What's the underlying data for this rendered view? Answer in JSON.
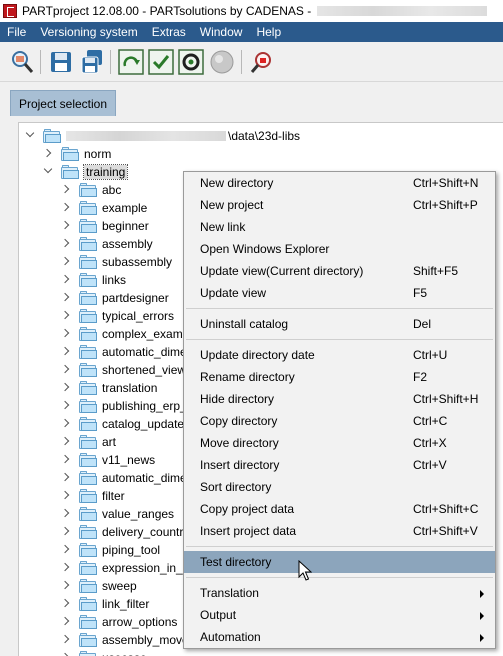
{
  "window": {
    "title": "PARTproject 12.08.00 - PARTsolutions by CADENAS - "
  },
  "menubar": {
    "items": [
      "File",
      "Versioning system",
      "Extras",
      "Window",
      "Help"
    ]
  },
  "toolbar": {
    "buttons": [
      "search-icon",
      "save-icon",
      "save-all-icon",
      "refresh-icon",
      "check-icon",
      "settings-icon",
      "globe-icon",
      "stop-search-icon"
    ]
  },
  "tabs": {
    "project_selection": "Project selection"
  },
  "tree": {
    "root_path": "\\data\\23d-libs",
    "norm": "norm",
    "training": "training",
    "children": [
      "abc",
      "example",
      "beginner",
      "assembly",
      "subassembly",
      "links",
      "partdesigner",
      "typical_errors",
      "complex_examp",
      "automatic_dime",
      "shortened_view",
      "translation",
      "publishing_erp_",
      "catalog_update_",
      "art",
      "v11_news",
      "automatic_dime",
      "filter",
      "value_ranges",
      "delivery_countr",
      "piping_tool",
      "expression_in_s",
      "sweep",
      "link_filter",
      "arrow_options",
      "assembly_move",
      "usecase"
    ]
  },
  "context_menu": {
    "items": [
      {
        "label": "New directory",
        "shortcut": "Ctrl+Shift+N"
      },
      {
        "label": "New project",
        "shortcut": "Ctrl+Shift+P"
      },
      {
        "label": "New link",
        "shortcut": ""
      },
      {
        "label": "Open Windows Explorer",
        "shortcut": ""
      },
      {
        "label": "Update view(Current directory)",
        "shortcut": "Shift+F5"
      },
      {
        "label": "Update view",
        "shortcut": "F5"
      },
      {
        "label": "Uninstall catalog",
        "shortcut": "Del"
      },
      {
        "label": "Update directory date",
        "shortcut": "Ctrl+U"
      },
      {
        "label": "Rename directory",
        "shortcut": "F2"
      },
      {
        "label": "Hide directory",
        "shortcut": "Ctrl+Shift+H"
      },
      {
        "label": "Copy directory",
        "shortcut": "Ctrl+C"
      },
      {
        "label": "Move directory",
        "shortcut": "Ctrl+X"
      },
      {
        "label": "Insert directory",
        "shortcut": "Ctrl+V"
      },
      {
        "label": "Sort directory",
        "shortcut": ""
      },
      {
        "label": "Copy project data",
        "shortcut": "Ctrl+Shift+C"
      },
      {
        "label": "Insert project data",
        "shortcut": "Ctrl+Shift+V"
      },
      {
        "label": "Test directory",
        "shortcut": ""
      },
      {
        "label": "Translation",
        "shortcut": ""
      },
      {
        "label": "Output",
        "shortcut": ""
      },
      {
        "label": "Automation",
        "shortcut": ""
      }
    ]
  },
  "colors": {
    "menubar": "#2b5a8c",
    "highlight": "#8ca5bc",
    "tab": "#a8bfd4"
  }
}
